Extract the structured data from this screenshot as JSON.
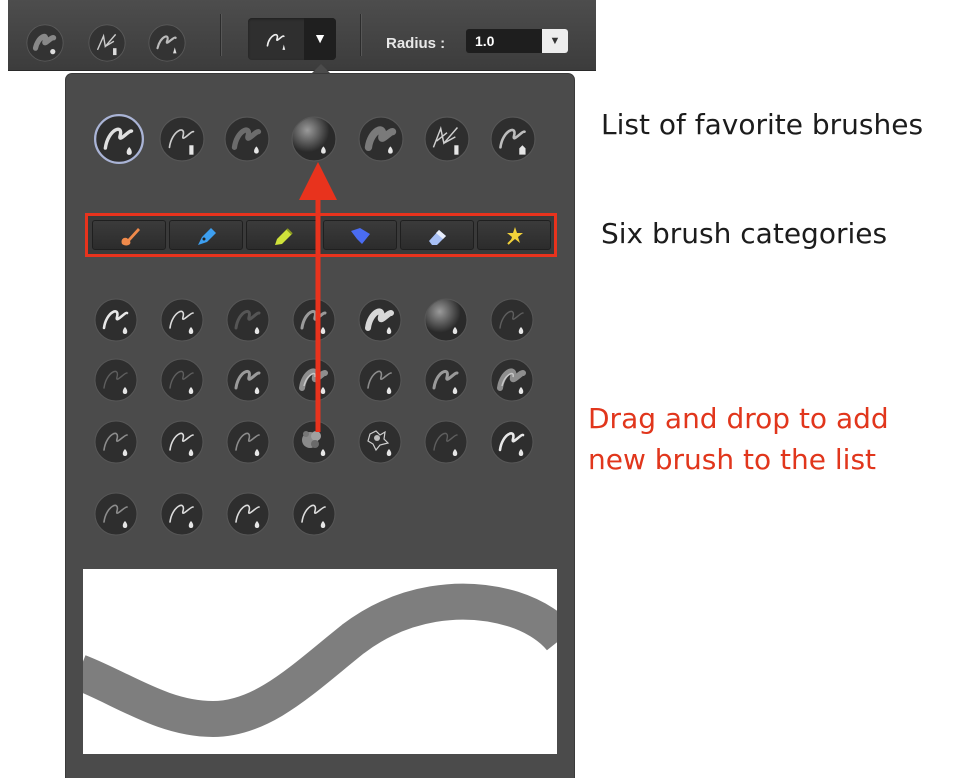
{
  "toolbar": {
    "brushes": [
      "round-soft-brush",
      "ink-pen-brush",
      "dry-brush"
    ],
    "current_brush": "pencil-brush",
    "radius_label": "Radius :",
    "radius_value": "1.0"
  },
  "favorites": [
    "selected-brush",
    "ink-pen-brush",
    "dry-brush",
    "soft-airbrush",
    "broad-brush",
    "feather-brush",
    "marker-brush"
  ],
  "categories": [
    {
      "name": "paintbrush",
      "color": "#f08a4b"
    },
    {
      "name": "ink-pen",
      "color": "#3d9ff0"
    },
    {
      "name": "highlighter",
      "color": "#cfe23a"
    },
    {
      "name": "marker",
      "color": "#4a6cf2"
    },
    {
      "name": "eraser",
      "color": "#a8c0f5"
    },
    {
      "name": "special-effects",
      "color": "#f2d23a"
    }
  ],
  "brush_rows": [
    7,
    7,
    7,
    4
  ],
  "annotations": {
    "favorites": "List of favorite brushes",
    "categories": "Six brush categories",
    "drag_line1": "Drag and drop to add",
    "drag_line2": "new brush to the list"
  },
  "colors": {
    "toolbar_bg": "#444444",
    "panel_bg": "#4b4b4b",
    "highlight": "#e8331d",
    "annotation_red": "#e1361c"
  }
}
